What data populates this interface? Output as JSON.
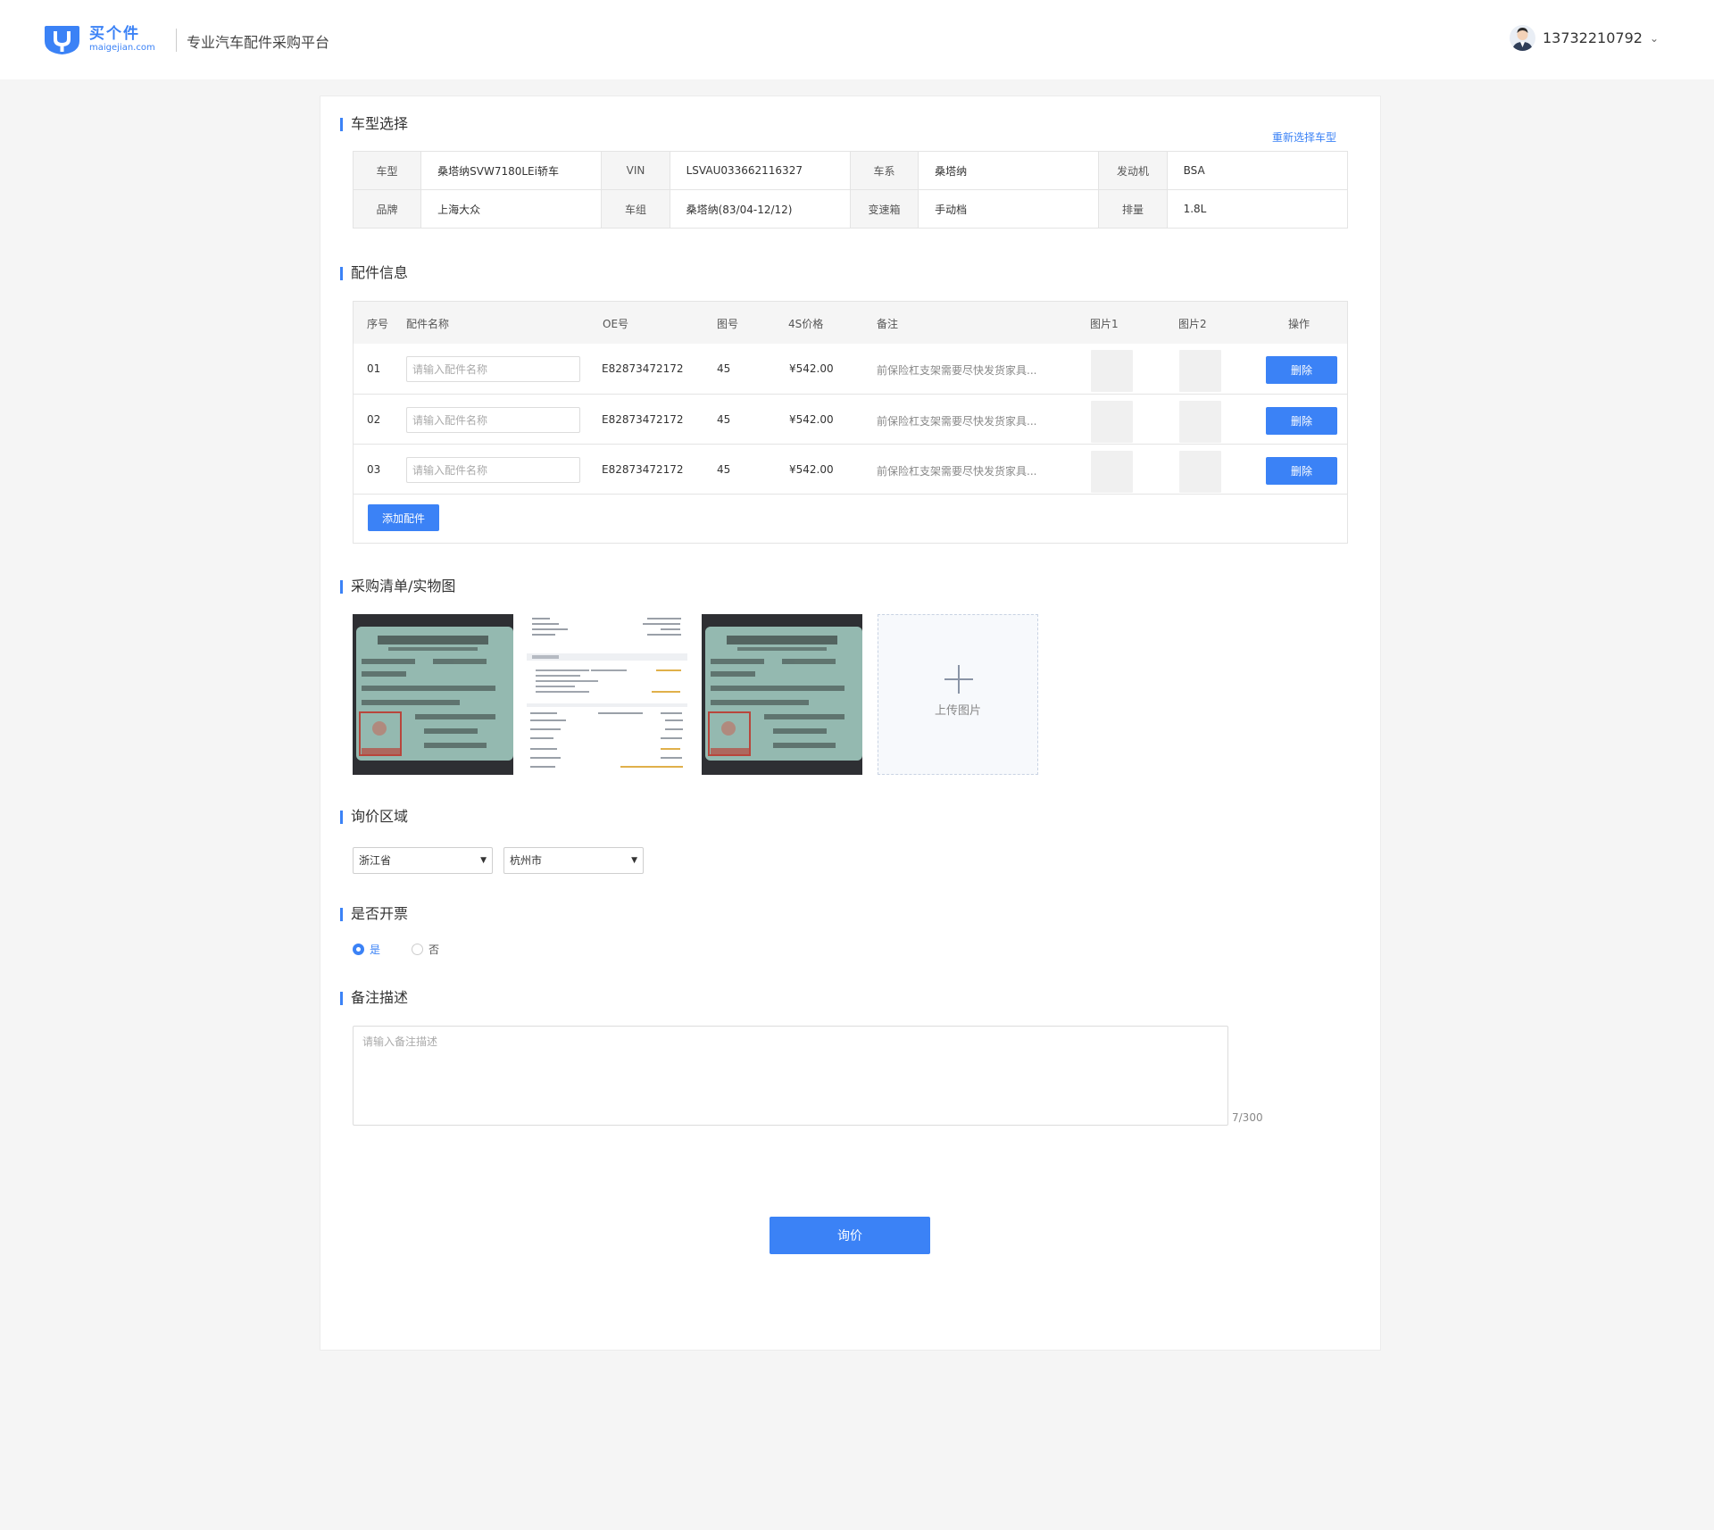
{
  "header": {
    "logo_cn": "买个件",
    "logo_en": "maigejian.com",
    "slogan": "专业汽车配件采购平台",
    "phone": "13732210792"
  },
  "vehicle": {
    "title": "车型选择",
    "reselect": "重新选择车型",
    "row1": [
      {
        "label": "车型",
        "value": "桑塔纳SVW7180LEi轿车"
      },
      {
        "label": "VIN",
        "value": "LSVAU033662116327"
      },
      {
        "label": "车系",
        "value": "桑塔纳"
      },
      {
        "label": "发动机",
        "value": "BSA"
      }
    ],
    "row2": [
      {
        "label": "品牌",
        "value": "上海大众"
      },
      {
        "label": "车组",
        "value": "桑塔纳(83/04-12/12)"
      },
      {
        "label": "变速箱",
        "value": "手动档"
      },
      {
        "label": "排量",
        "value": "1.8L"
      }
    ]
  },
  "parts": {
    "title": "配件信息",
    "columns": [
      "序号",
      "配件名称",
      "OE号",
      "图号",
      "4S价格",
      "备注",
      "图片1",
      "图片2",
      "操作"
    ],
    "placeholder": "请输入配件名称",
    "rows": [
      {
        "no": "01",
        "oe": "E82873472172",
        "fig": "45",
        "price": "¥542.00",
        "remark": "前保险杠支架需要尽快发货家具..."
      },
      {
        "no": "02",
        "oe": "E82873472172",
        "fig": "45",
        "price": "¥542.00",
        "remark": "前保险杠支架需要尽快发货家具..."
      },
      {
        "no": "03",
        "oe": "E82873472172",
        "fig": "45",
        "price": "¥542.00",
        "remark": "前保险杠支架需要尽快发货家具..."
      }
    ],
    "delete_label": "删除",
    "add_label": "添加配件"
  },
  "photos": {
    "title": "采购清单/实物图",
    "upload_label": "上传图片"
  },
  "region": {
    "title": "询价区域",
    "province": "浙江省",
    "city": "杭州市"
  },
  "invoice": {
    "title": "是否开票",
    "yes": "是",
    "no": "否",
    "selected": "是"
  },
  "remark": {
    "title": "备注描述",
    "placeholder": "请输入备注描述",
    "counter": "7/300"
  },
  "submit_label": "询价",
  "colors": {
    "accent": "#3b82f6"
  }
}
